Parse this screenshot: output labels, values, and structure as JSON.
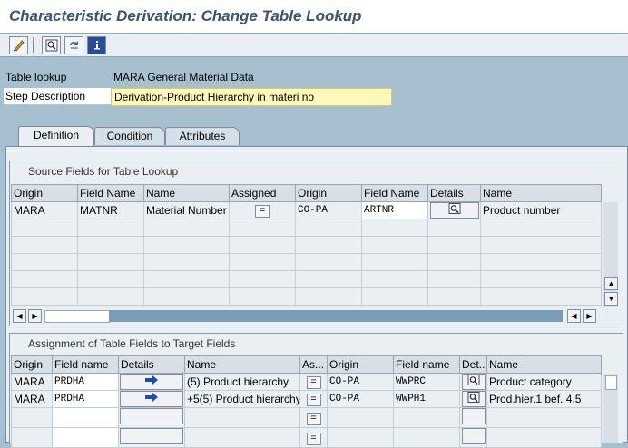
{
  "title": "Characteristic Derivation: Change Table Lookup",
  "header": {
    "table_lookup_label": "Table lookup",
    "table_lookup_value": "MARA General Material Data",
    "step_description_label": "Step Description",
    "step_description_value": "Derivation-Product Hierarchy in materi no"
  },
  "tabs": [
    "Definition",
    "Condition",
    "Attributes"
  ],
  "source_group": {
    "title": "Source Fields for Table Lookup",
    "columns": [
      "Origin",
      "Field Name",
      "Name",
      "Assigned",
      "Origin",
      "Field Name",
      "Details",
      "Name"
    ],
    "rows": [
      {
        "origin": "MARA",
        "field": "MATNR",
        "name": "Material Number",
        "assigned": "=",
        "origin2": "CO-PA",
        "field2": "ARTNR",
        "name2": "Product number"
      }
    ]
  },
  "target_group": {
    "title": "Assignment of Table Fields to Target Fields",
    "columns": [
      "Origin",
      "Field name",
      "Details",
      "Name",
      "As...",
      "Origin",
      "Field name",
      "Det...",
      "Name"
    ],
    "rows": [
      {
        "origin": "MARA",
        "field": "PRDHA",
        "name": "(5) Product hierarchy",
        "as": "=",
        "origin2": "CO-PA",
        "field2": "WWPRC",
        "name2": "Product category"
      },
      {
        "origin": "MARA",
        "field": "PRDHA",
        "name": "+5(5) Product hierarchy",
        "as": "=",
        "origin2": "CO-PA",
        "field2": "WWPH1",
        "name2": "Prod.hier.1 bef. 4.5"
      }
    ]
  }
}
